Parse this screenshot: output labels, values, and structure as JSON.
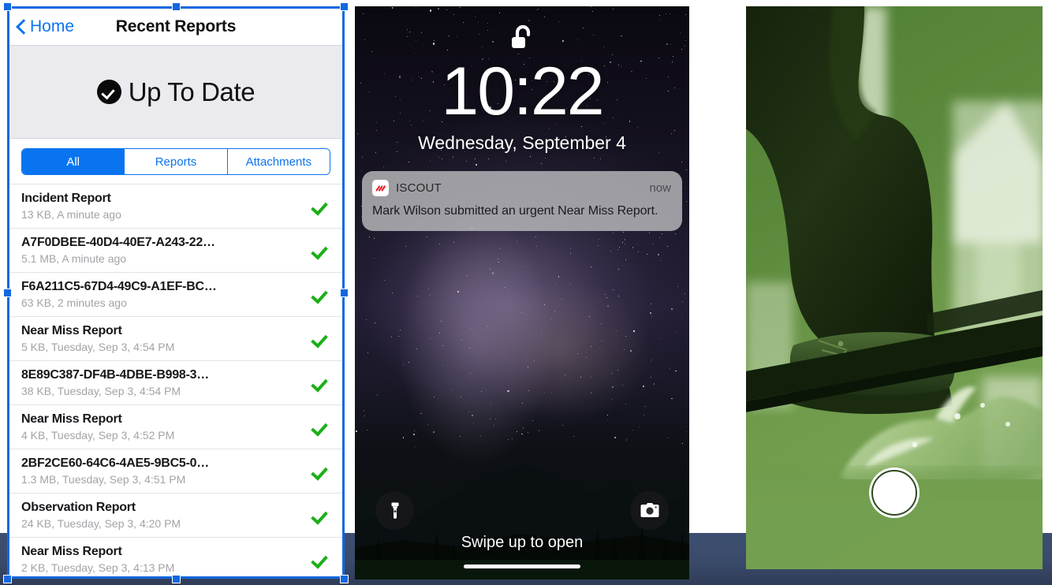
{
  "left_panel": {
    "nav": {
      "back_label": "Home",
      "back_icon": "chevron-left-icon",
      "title": "Recent Reports"
    },
    "status_banner": {
      "icon": "check-circle-icon",
      "text": "Up To Date"
    },
    "segmented_control": {
      "options": [
        {
          "label": "All",
          "active": true
        },
        {
          "label": "Reports",
          "active": false
        },
        {
          "label": "Attachments",
          "active": false
        }
      ]
    },
    "rows": [
      {
        "title": "Incident Report",
        "meta": "13 KB, A minute ago",
        "status_icon": "green-check-icon"
      },
      {
        "title": "A7F0DBEE-40D4-40E7-A243-22…",
        "meta": "5.1 MB, A minute ago",
        "status_icon": "green-check-icon"
      },
      {
        "title": "F6A211C5-67D4-49C9-A1EF-BC…",
        "meta": "63 KB, 2 minutes ago",
        "status_icon": "green-check-icon"
      },
      {
        "title": "Near Miss Report",
        "meta": "5 KB, Tuesday, Sep 3, 4:54 PM",
        "status_icon": "green-check-icon"
      },
      {
        "title": "8E89C387-DF4B-4DBE-B998-3…",
        "meta": "38 KB, Tuesday, Sep 3, 4:54 PM",
        "status_icon": "green-check-icon"
      },
      {
        "title": "Near Miss Report",
        "meta": "4 KB, Tuesday, Sep 3, 4:52 PM",
        "status_icon": "green-check-icon"
      },
      {
        "title": "2BF2CE60-64C6-4AE5-9BC5-0…",
        "meta": "1.3 MB, Tuesday, Sep 3, 4:51 PM",
        "status_icon": "green-check-icon"
      },
      {
        "title": "Observation Report",
        "meta": "24 KB, Tuesday, Sep 3, 4:20 PM",
        "status_icon": "green-check-icon"
      },
      {
        "title": "Near Miss Report",
        "meta": "2 KB, Tuesday, Sep 3, 4:13 PM",
        "status_icon": "green-check-icon"
      }
    ]
  },
  "middle_panel": {
    "lock_icon": "unlocked-padlock-icon",
    "clock": "10:22",
    "date": "Wednesday, September 4",
    "notification": {
      "app_icon": "iscout-app-icon",
      "app_name": "ISCOUT",
      "time": "now",
      "body": "Mark Wilson submitted an urgent Near Miss Report."
    },
    "flashlight_icon": "flashlight-icon",
    "camera_icon": "camera-icon",
    "swipe_hint": "Swipe up to open",
    "home_indicator": "home-indicator"
  },
  "right_panel": {
    "photo_description": "boot-on-plank-photo",
    "shutter_button": "camera-shutter-button"
  },
  "colors": {
    "ios_blue": "#0a74f0",
    "green_check": "#1aaf17",
    "banner_bg": "#eaeaef",
    "selection_blue": "#1268e0",
    "navy_strip": "#3a4a6a",
    "photo_green": "#4b7a31"
  }
}
